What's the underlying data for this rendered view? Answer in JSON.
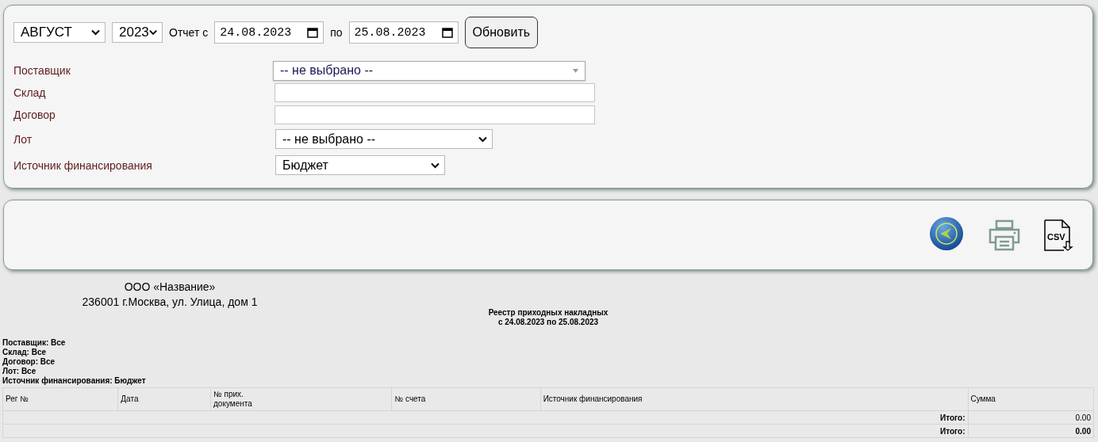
{
  "period": {
    "month": "АВГУСТ",
    "year": "2023",
    "from_label": "Отчет с",
    "from": "24.08.2023",
    "to_label": "по",
    "to": "25.08.2023",
    "refresh_button": "Обновить"
  },
  "filters": [
    {
      "label": "Поставщик",
      "kind": "combo",
      "value": "-- не выбрано --"
    },
    {
      "label": "Склад",
      "kind": "text"
    },
    {
      "label": "Договор",
      "kind": "text"
    },
    {
      "label": "Лот",
      "kind": "select",
      "value": "-- не выбрано --"
    },
    {
      "label": "Источник финансирования",
      "kind": "select",
      "value": "Бюджет"
    }
  ],
  "toolbar": [
    {
      "kind": "back"
    },
    {
      "kind": "print"
    },
    {
      "kind": "csv",
      "label": "CSV"
    }
  ],
  "report": {
    "company": "ООО «Название»",
    "address": "236001 г.Москва, ул. Улица, дом 1",
    "title": "Реестр приходных накладных",
    "subtitle": "с 24.08.2023 по 25.08.2023",
    "params": [
      "Поставщик: Все",
      "Склад: Все",
      "Договор: Все",
      "Лот: Все",
      "Источник финансирования: Бюджет"
    ],
    "columns": [
      "Рег №",
      "Дата",
      "№ прих.\nдокумента",
      "№ счета",
      "Источник финансирования",
      "Сумма"
    ],
    "totals": [
      {
        "label": "Итого:",
        "value": "0.00",
        "kind": "subtotal"
      },
      {
        "label": "Итого:",
        "value": "0.00",
        "kind": "grand"
      }
    ]
  }
}
